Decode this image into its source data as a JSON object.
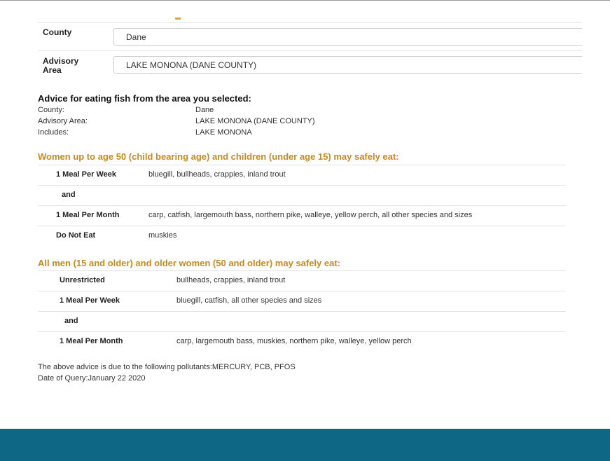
{
  "form": {
    "county_label": "County",
    "county_value": "Dane",
    "area_label_line1": "Advisory",
    "area_label_line2": "Area",
    "area_value": "LAKE MONONA (DANE COUNTY)"
  },
  "advice": {
    "heading": "Advice for eating fish from the area you selected:",
    "meta": [
      {
        "key": "County:",
        "value": "Dane"
      },
      {
        "key": "Advisory Area:",
        "value": "LAKE MONONA (DANE COUNTY)"
      },
      {
        "key": "Includes:",
        "value": "LAKE MONONA"
      }
    ]
  },
  "women_section": {
    "title": "Women up to age 50 (child bearing age) and children (under age 15) may safely eat:",
    "rows": [
      {
        "label": "1 Meal Per Week",
        "value": "bluegill, bullheads, crappies, inland trout"
      },
      {
        "label": "and",
        "value": ""
      },
      {
        "label": "1 Meal Per Month",
        "value": "carp, catfish, largemouth bass, northern pike, walleye, yellow perch, all other species and sizes"
      },
      {
        "label": "Do Not Eat",
        "value": "muskies"
      }
    ]
  },
  "men_section": {
    "title": "All men (15 and older) and older women (50 and older) may safely eat:",
    "rows": [
      {
        "label": "Unrestricted",
        "value": "bullheads, crappies, inland trout"
      },
      {
        "label": "1 Meal Per Week",
        "value": "bluegill, catfish, all other species and sizes"
      },
      {
        "label": "and",
        "value": ""
      },
      {
        "label": "1 Meal Per Month",
        "value": "carp, largemouth bass, muskies, northern pike, walleye, yellow perch"
      }
    ]
  },
  "footnote": {
    "pollutants": "The above advice is due to the following pollutants:MERCURY, PCB, PFOS",
    "date": "Date of Query:January 22 2020"
  },
  "colors": {
    "section_title": "#c68a1f",
    "footer": "#0e6785"
  }
}
